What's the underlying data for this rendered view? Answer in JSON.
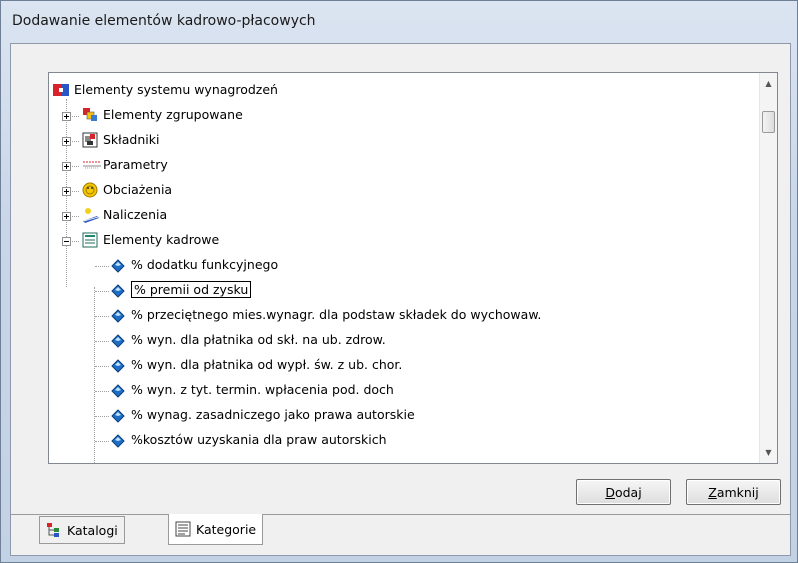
{
  "window": {
    "title": "Dodawanie elementów kadrowo-płacowych"
  },
  "tree": {
    "root": {
      "label": "Elementy systemu wynagrodzeń",
      "icon": "tree-root-icon"
    },
    "groups": [
      {
        "label": "Elementy zgrupowane",
        "icon": "grouped-elements-icon",
        "expanded": false
      },
      {
        "label": "Składniki",
        "icon": "components-icon",
        "expanded": false
      },
      {
        "label": "Parametry",
        "icon": "parameters-icon",
        "expanded": false
      },
      {
        "label": "Obciażenia",
        "icon": "charges-icon",
        "expanded": false
      },
      {
        "label": "Naliczenia",
        "icon": "calculations-icon",
        "expanded": false
      },
      {
        "label": "Elementy kadrowe",
        "icon": "hr-elements-icon",
        "expanded": true
      }
    ],
    "items": [
      {
        "label": "% dodatku funkcyjnego"
      },
      {
        "label": "% premii od zysku",
        "selected": true
      },
      {
        "label": "% przeciętnego mies.wynagr. dla podstaw składek do wychowaw."
      },
      {
        "label": "% wyn. dla płatnika od skł. na ub. zdrow."
      },
      {
        "label": "% wyn. dla płatnika od wypł. św. z ub. chor."
      },
      {
        "label": "% wyn. z tyt. termin. wpłacenia pod. doch"
      },
      {
        "label": "% wynag. zasadniczego jako prawa autorskie"
      },
      {
        "label": "%kosztów uzyskania dla praw autorskich"
      }
    ]
  },
  "buttons": {
    "add": {
      "mnemonic": "D",
      "rest": "odaj"
    },
    "close": {
      "mnemonic": "Z",
      "rest": "amknij"
    }
  },
  "tabs": [
    {
      "label": "Katalogi",
      "active": false,
      "icon": "catalog-tree-icon"
    },
    {
      "label": "Kategorie",
      "active": true,
      "icon": "categories-list-icon"
    }
  ],
  "colors": {
    "item_icon": "#1e6ec8",
    "selection_border": "#000000"
  }
}
